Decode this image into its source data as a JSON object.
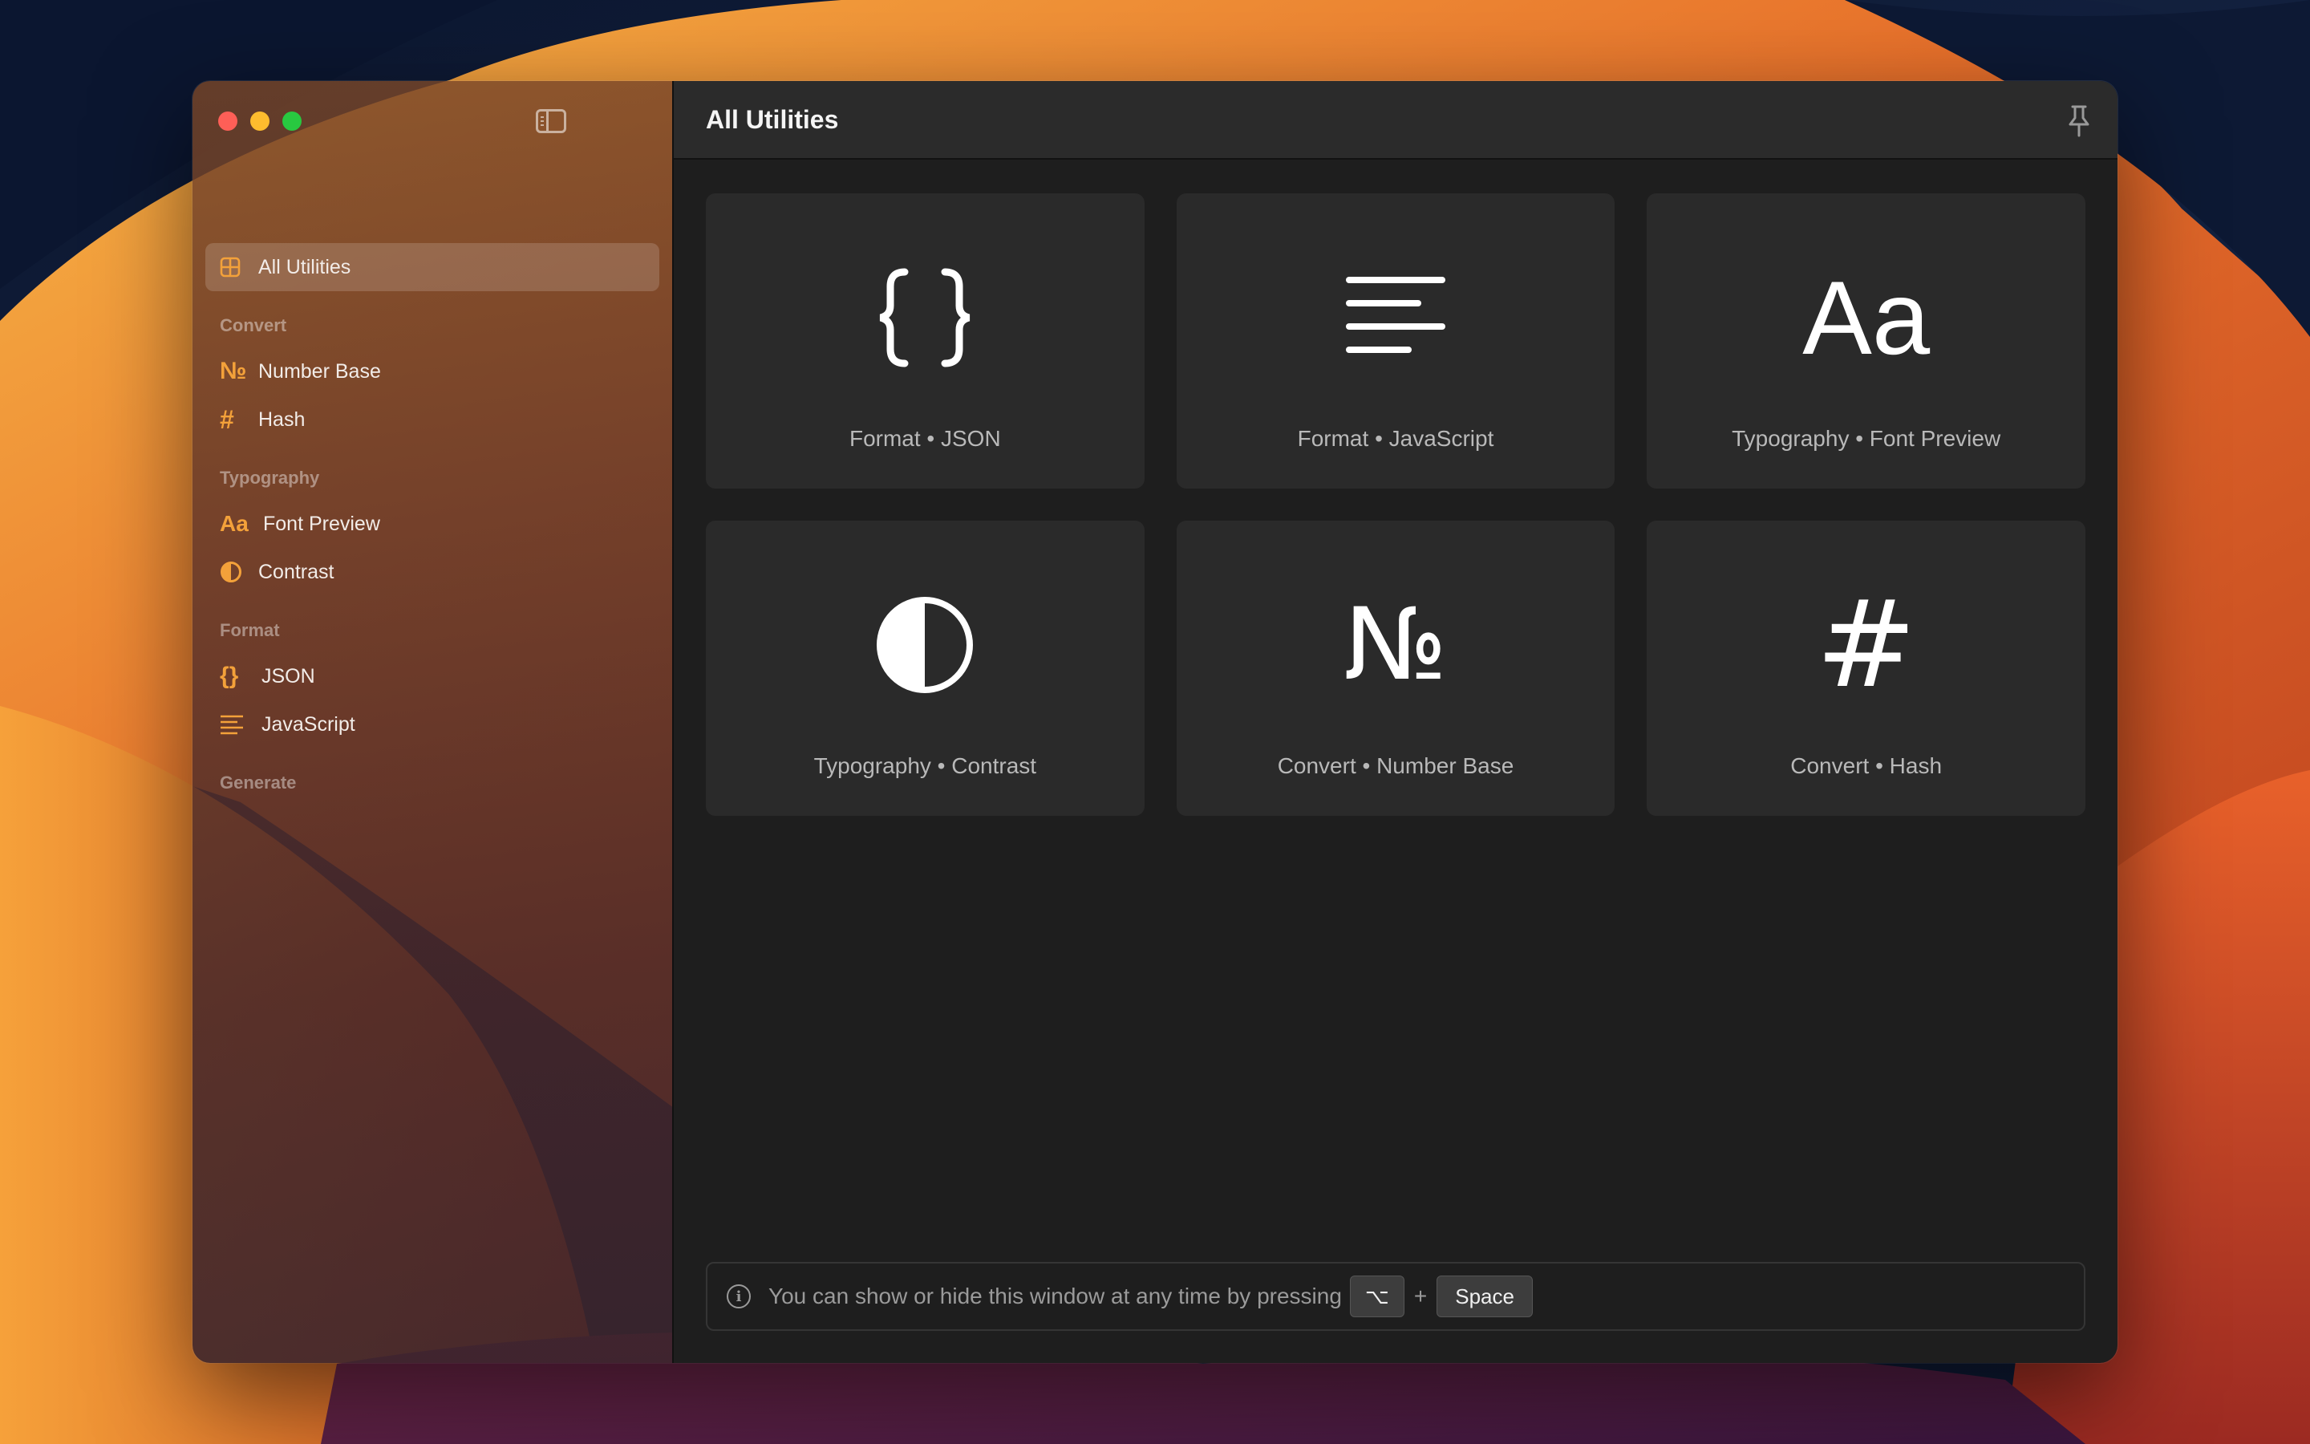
{
  "colors": {
    "accent": "#f3a13a",
    "window_bg": "#1e1e1e",
    "card_bg": "#2a2a2a",
    "titlebar_bg": "#2b2b2b"
  },
  "window": {
    "title": "All Utilities",
    "pin_icon": "pin-icon"
  },
  "sidebar": {
    "active": {
      "label": "All Utilities",
      "icon": "grid-icon"
    },
    "sections": [
      {
        "label": "Convert",
        "items": [
          {
            "label": "Number Base",
            "icon": "numero-icon"
          },
          {
            "label": "Hash",
            "icon": "hash-icon"
          }
        ]
      },
      {
        "label": "Typography",
        "items": [
          {
            "label": "Font Preview",
            "icon": "font-icon"
          },
          {
            "label": "Contrast",
            "icon": "contrast-icon"
          }
        ]
      },
      {
        "label": "Format",
        "items": [
          {
            "label": "JSON",
            "icon": "braces-icon"
          },
          {
            "label": "JavaScript",
            "icon": "lines-icon"
          }
        ]
      },
      {
        "label": "Generate",
        "items": []
      }
    ]
  },
  "cards": [
    {
      "caption": "Format • JSON",
      "icon": "braces-icon",
      "glyph": "{}"
    },
    {
      "caption": "Format • JavaScript",
      "icon": "text-lines-icon"
    },
    {
      "caption": "Typography • Font Preview",
      "icon": "font-icon",
      "glyph": "Aa"
    },
    {
      "caption": "Typography • Contrast",
      "icon": "contrast-icon"
    },
    {
      "caption": "Convert • Number Base",
      "icon": "numero-icon",
      "glyph": "№"
    },
    {
      "caption": "Convert • Hash",
      "icon": "hash-icon",
      "glyph": "#"
    }
  ],
  "info": {
    "text": "You can show or hide this window at any time by pressing",
    "key1": "⌥",
    "plus": "+",
    "key2": "Space"
  }
}
